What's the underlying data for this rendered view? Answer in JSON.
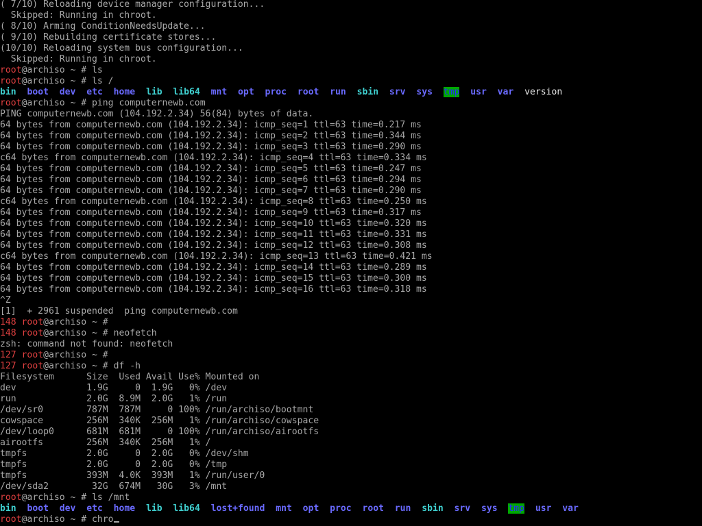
{
  "colors": {
    "background": "#000000",
    "default": "#a8a8a8",
    "red": "#e04040",
    "blue": "#6a6aff",
    "cyan": "#3fd0d0",
    "highlight_bg": "#00a800",
    "highlight_fg": "#2a2aff",
    "bright": "#e8e8e8"
  },
  "cursor_icon": "underscore-cursor",
  "lines": [
    [
      {
        "t": "( 7/10) Reloading device manager configuration...",
        "c": "default"
      }
    ],
    [
      {
        "t": "  Skipped: Running in chroot.",
        "c": "default"
      }
    ],
    [
      {
        "t": "( 8/10) Arming ConditionNeedsUpdate...",
        "c": "default"
      }
    ],
    [
      {
        "t": "( 9/10) Rebuilding certificate stores...",
        "c": "default"
      }
    ],
    [
      {
        "t": "(10/10) Reloading system bus configuration...",
        "c": "default"
      }
    ],
    [
      {
        "t": "  Skipped: Running in chroot.",
        "c": "default"
      }
    ],
    [
      {
        "t": "root",
        "c": "red"
      },
      {
        "t": "@archiso ~ # ls",
        "c": "default"
      }
    ],
    [
      {
        "t": "root",
        "c": "red"
      },
      {
        "t": "@archiso ~ # ls /",
        "c": "default"
      }
    ],
    [
      {
        "t": "bin",
        "c": "cyan"
      },
      {
        "t": "  ",
        "c": "default"
      },
      {
        "t": "boot",
        "c": "blue"
      },
      {
        "t": "  ",
        "c": "default"
      },
      {
        "t": "dev",
        "c": "blue"
      },
      {
        "t": "  ",
        "c": "default"
      },
      {
        "t": "etc",
        "c": "blue"
      },
      {
        "t": "  ",
        "c": "default"
      },
      {
        "t": "home",
        "c": "blue"
      },
      {
        "t": "  ",
        "c": "default"
      },
      {
        "t": "lib",
        "c": "cyan"
      },
      {
        "t": "  ",
        "c": "default"
      },
      {
        "t": "lib64",
        "c": "cyan"
      },
      {
        "t": "  ",
        "c": "default"
      },
      {
        "t": "mnt",
        "c": "blue"
      },
      {
        "t": "  ",
        "c": "default"
      },
      {
        "t": "opt",
        "c": "blue"
      },
      {
        "t": "  ",
        "c": "default"
      },
      {
        "t": "proc",
        "c": "blue"
      },
      {
        "t": "  ",
        "c": "default"
      },
      {
        "t": "root",
        "c": "blue"
      },
      {
        "t": "  ",
        "c": "default"
      },
      {
        "t": "run",
        "c": "blue"
      },
      {
        "t": "  ",
        "c": "default"
      },
      {
        "t": "sbin",
        "c": "cyan"
      },
      {
        "t": "  ",
        "c": "default"
      },
      {
        "t": "srv",
        "c": "blue"
      },
      {
        "t": "  ",
        "c": "default"
      },
      {
        "t": "sys",
        "c": "blue"
      },
      {
        "t": "  ",
        "c": "default"
      },
      {
        "t": "tmp",
        "c": "hl"
      },
      {
        "t": "  ",
        "c": "default"
      },
      {
        "t": "usr",
        "c": "blue"
      },
      {
        "t": "  ",
        "c": "default"
      },
      {
        "t": "var",
        "c": "blue"
      },
      {
        "t": "  version",
        "c": "bright"
      }
    ],
    [
      {
        "t": "root",
        "c": "red"
      },
      {
        "t": "@archiso ~ # ping computernewb.com",
        "c": "default"
      }
    ],
    [
      {
        "t": "PING computernewb.com (104.192.2.34) 56(84) bytes of data.",
        "c": "default"
      }
    ],
    [
      {
        "t": "64 bytes from computernewb.com (104.192.2.34): icmp_seq=1 ttl=63 time=0.217 ms",
        "c": "default"
      }
    ],
    [
      {
        "t": "64 bytes from computernewb.com (104.192.2.34): icmp_seq=2 ttl=63 time=0.344 ms",
        "c": "default"
      }
    ],
    [
      {
        "t": "64 bytes from computernewb.com (104.192.2.34): icmp_seq=3 ttl=63 time=0.290 ms",
        "c": "default"
      }
    ],
    [
      {
        "t": "c64 bytes from computernewb.com (104.192.2.34): icmp_seq=4 ttl=63 time=0.334 ms",
        "c": "default"
      }
    ],
    [
      {
        "t": "64 bytes from computernewb.com (104.192.2.34): icmp_seq=5 ttl=63 time=0.247 ms",
        "c": "default"
      }
    ],
    [
      {
        "t": "64 bytes from computernewb.com (104.192.2.34): icmp_seq=6 ttl=63 time=0.294 ms",
        "c": "default"
      }
    ],
    [
      {
        "t": "64 bytes from computernewb.com (104.192.2.34): icmp_seq=7 ttl=63 time=0.290 ms",
        "c": "default"
      }
    ],
    [
      {
        "t": "c64 bytes from computernewb.com (104.192.2.34): icmp_seq=8 ttl=63 time=0.250 ms",
        "c": "default"
      }
    ],
    [
      {
        "t": "64 bytes from computernewb.com (104.192.2.34): icmp_seq=9 ttl=63 time=0.317 ms",
        "c": "default"
      }
    ],
    [
      {
        "t": "64 bytes from computernewb.com (104.192.2.34): icmp_seq=10 ttl=63 time=0.320 ms",
        "c": "default"
      }
    ],
    [
      {
        "t": "64 bytes from computernewb.com (104.192.2.34): icmp_seq=11 ttl=63 time=0.331 ms",
        "c": "default"
      }
    ],
    [
      {
        "t": "64 bytes from computernewb.com (104.192.2.34): icmp_seq=12 ttl=63 time=0.308 ms",
        "c": "default"
      }
    ],
    [
      {
        "t": "c64 bytes from computernewb.com (104.192.2.34): icmp_seq=13 ttl=63 time=0.421 ms",
        "c": "default"
      }
    ],
    [
      {
        "t": "64 bytes from computernewb.com (104.192.2.34): icmp_seq=14 ttl=63 time=0.289 ms",
        "c": "default"
      }
    ],
    [
      {
        "t": "64 bytes from computernewb.com (104.192.2.34): icmp_seq=15 ttl=63 time=0.300 ms",
        "c": "default"
      }
    ],
    [
      {
        "t": "64 bytes from computernewb.com (104.192.2.34): icmp_seq=16 ttl=63 time=0.318 ms",
        "c": "default"
      }
    ],
    [
      {
        "t": "^Z",
        "c": "default"
      }
    ],
    [
      {
        "t": "[1]  + 2961 suspended  ping computernewb.com",
        "c": "default"
      }
    ],
    [
      {
        "t": "148",
        "c": "red"
      },
      {
        "t": " ",
        "c": "default"
      },
      {
        "t": "root",
        "c": "red"
      },
      {
        "t": "@archiso ~ #",
        "c": "default"
      }
    ],
    [
      {
        "t": "148",
        "c": "red"
      },
      {
        "t": " ",
        "c": "default"
      },
      {
        "t": "root",
        "c": "red"
      },
      {
        "t": "@archiso ~ # neofetch",
        "c": "default"
      }
    ],
    [
      {
        "t": "zsh: command not found: neofetch",
        "c": "default"
      }
    ],
    [
      {
        "t": "127",
        "c": "red"
      },
      {
        "t": " ",
        "c": "default"
      },
      {
        "t": "root",
        "c": "red"
      },
      {
        "t": "@archiso ~ #",
        "c": "default"
      }
    ],
    [
      {
        "t": "127",
        "c": "red"
      },
      {
        "t": " ",
        "c": "default"
      },
      {
        "t": "root",
        "c": "red"
      },
      {
        "t": "@archiso ~ # df -h",
        "c": "default"
      }
    ],
    [
      {
        "t": "Filesystem      Size  Used Avail Use% Mounted on",
        "c": "default"
      }
    ],
    [
      {
        "t": "dev             1.9G     0  1.9G   0% /dev",
        "c": "default"
      }
    ],
    [
      {
        "t": "run             2.0G  8.9M  2.0G   1% /run",
        "c": "default"
      }
    ],
    [
      {
        "t": "/dev/sr0        787M  787M     0 100% /run/archiso/bootmnt",
        "c": "default"
      }
    ],
    [
      {
        "t": "cowspace        256M  340K  256M   1% /run/archiso/cowspace",
        "c": "default"
      }
    ],
    [
      {
        "t": "/dev/loop0      681M  681M     0 100% /run/archiso/airootfs",
        "c": "default"
      }
    ],
    [
      {
        "t": "airootfs        256M  340K  256M   1% /",
        "c": "default"
      }
    ],
    [
      {
        "t": "tmpfs           2.0G     0  2.0G   0% /dev/shm",
        "c": "default"
      }
    ],
    [
      {
        "t": "tmpfs           2.0G     0  2.0G   0% /tmp",
        "c": "default"
      }
    ],
    [
      {
        "t": "tmpfs           393M  4.0K  393M   1% /run/user/0",
        "c": "default"
      }
    ],
    [
      {
        "t": "/dev/sda2        32G  674M   30G   3% /mnt",
        "c": "default"
      }
    ],
    [
      {
        "t": "root",
        "c": "red"
      },
      {
        "t": "@archiso ~ # ls /mnt",
        "c": "default"
      }
    ],
    [
      {
        "t": "bin",
        "c": "cyan"
      },
      {
        "t": "  ",
        "c": "default"
      },
      {
        "t": "boot",
        "c": "blue"
      },
      {
        "t": "  ",
        "c": "default"
      },
      {
        "t": "dev",
        "c": "blue"
      },
      {
        "t": "  ",
        "c": "default"
      },
      {
        "t": "etc",
        "c": "blue"
      },
      {
        "t": "  ",
        "c": "default"
      },
      {
        "t": "home",
        "c": "blue"
      },
      {
        "t": "  ",
        "c": "default"
      },
      {
        "t": "lib",
        "c": "cyan"
      },
      {
        "t": "  ",
        "c": "default"
      },
      {
        "t": "lib64",
        "c": "cyan"
      },
      {
        "t": "  ",
        "c": "default"
      },
      {
        "t": "lost+found",
        "c": "blue"
      },
      {
        "t": "  ",
        "c": "default"
      },
      {
        "t": "mnt",
        "c": "blue"
      },
      {
        "t": "  ",
        "c": "default"
      },
      {
        "t": "opt",
        "c": "blue"
      },
      {
        "t": "  ",
        "c": "default"
      },
      {
        "t": "proc",
        "c": "blue"
      },
      {
        "t": "  ",
        "c": "default"
      },
      {
        "t": "root",
        "c": "blue"
      },
      {
        "t": "  ",
        "c": "default"
      },
      {
        "t": "run",
        "c": "blue"
      },
      {
        "t": "  ",
        "c": "default"
      },
      {
        "t": "sbin",
        "c": "cyan"
      },
      {
        "t": "  ",
        "c": "default"
      },
      {
        "t": "srv",
        "c": "blue"
      },
      {
        "t": "  ",
        "c": "default"
      },
      {
        "t": "sys",
        "c": "blue"
      },
      {
        "t": "  ",
        "c": "default"
      },
      {
        "t": "tmp",
        "c": "hl"
      },
      {
        "t": "  ",
        "c": "default"
      },
      {
        "t": "usr",
        "c": "blue"
      },
      {
        "t": "  ",
        "c": "default"
      },
      {
        "t": "var",
        "c": "blue"
      }
    ],
    [
      {
        "t": "root",
        "c": "red"
      },
      {
        "t": "@archiso ~ # chro",
        "c": "default"
      }
    ]
  ]
}
